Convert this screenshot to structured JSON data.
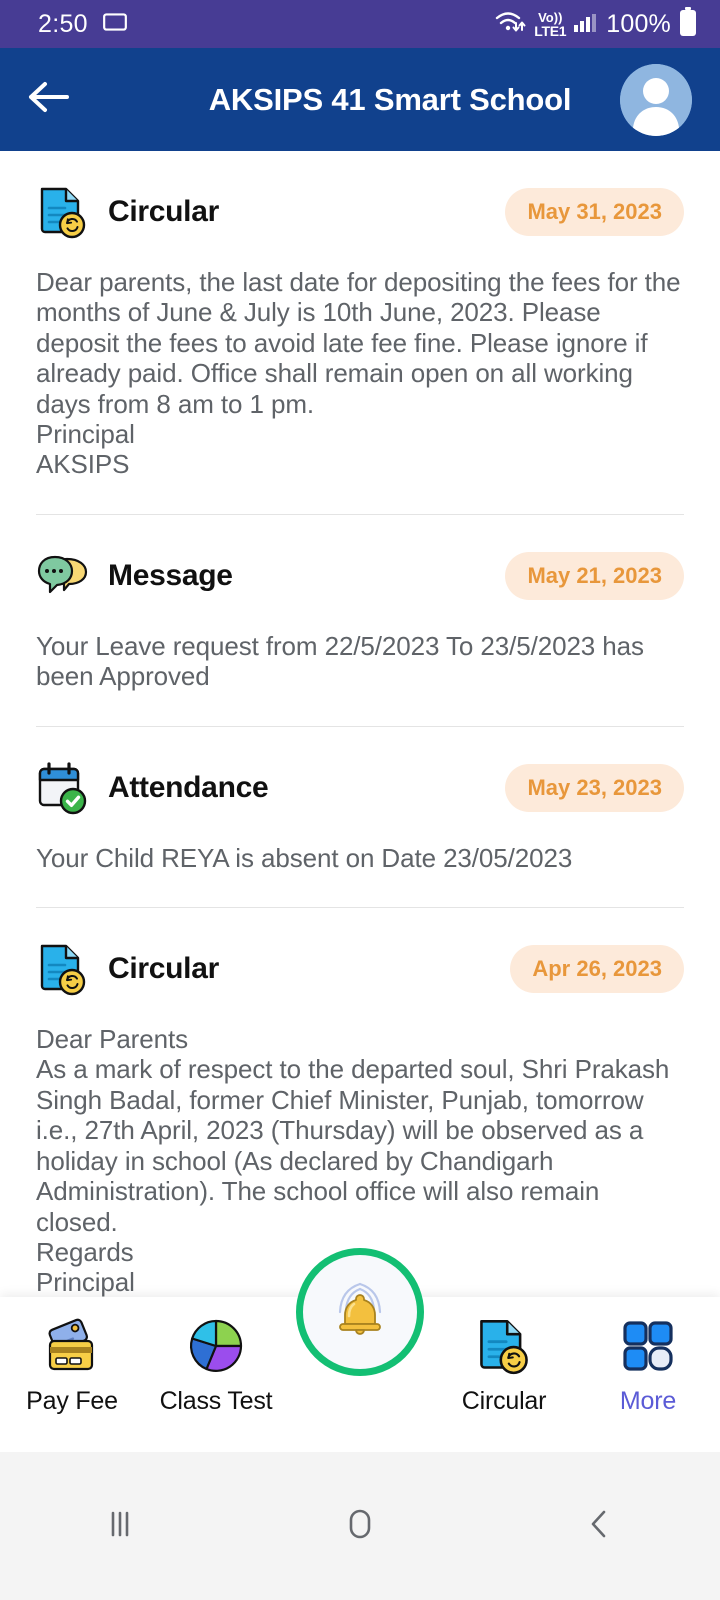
{
  "status_bar": {
    "time": "2:50",
    "battery_percent": "100%",
    "network_label": "LTE1",
    "volte_label": "Vo))",
    "icons": [
      "cast-icon",
      "wifi-icon",
      "volte-icon",
      "signal-icon",
      "battery-icon"
    ]
  },
  "app_bar": {
    "title": "AKSIPS 41 Smart School",
    "back_icon": "arrow-left-icon",
    "avatar_icon": "user-avatar-icon"
  },
  "feed": {
    "items": [
      {
        "type": "Circular",
        "icon": "circular-document-icon",
        "title": "Circular",
        "date": "May 31, 2023",
        "body": "Dear parents, the last date for depositing the fees for the months of June & July is 10th June, 2023. Please deposit the fees to avoid late fee fine. Please ignore if already paid. Office shall remain open on all working days from 8 am to 1 pm.\nPrincipal\nAKSIPS"
      },
      {
        "type": "Message",
        "icon": "message-bubble-icon",
        "title": "Message",
        "date": "May 21, 2023",
        "body": "Your Leave request from 22/5/2023 To 23/5/2023 has been Approved"
      },
      {
        "type": "Attendance",
        "icon": "attendance-calendar-icon",
        "title": "Attendance",
        "date": "May 23, 2023",
        "body": "Your Child REYA is absent on Date 23/05/2023"
      },
      {
        "type": "Circular",
        "icon": "circular-document-icon",
        "title": "Circular",
        "date": "Apr 26, 2023",
        "body": "Dear Parents\nAs a mark of respect to the departed soul, Shri Prakash Singh Badal, former Chief Minister, Punjab, tomorrow i.e., 27th April, 2023 (Thursday) will be observed as a holiday in school (As declared by Chandigarh Administration). The school office will also remain closed.\nRegards\nPrincipal"
      }
    ]
  },
  "bottom_nav": {
    "items": [
      {
        "label": "Pay Fee",
        "icon": "pay-fee-card-icon",
        "active": false
      },
      {
        "label": "Class Test",
        "icon": "pie-chart-icon",
        "active": false
      },
      {
        "label": "",
        "icon": "notification-bell-icon",
        "active": false
      },
      {
        "label": "Circular",
        "icon": "circular-document-icon",
        "active": false
      },
      {
        "label": "More",
        "icon": "grid-more-icon",
        "active": true
      }
    ]
  },
  "system_nav": {
    "recents_icon": "recents-icon",
    "home_icon": "home-icon",
    "back_icon": "back-chevron-icon"
  },
  "colors": {
    "status_bar_bg": "#473c94",
    "app_bar_bg": "#11418d",
    "date_pill_bg": "#fdeada",
    "date_pill_text": "#e8973b",
    "accent_more": "#5b5bd6",
    "fab_ring": "#13bf73",
    "body_text": "#5f6368"
  }
}
